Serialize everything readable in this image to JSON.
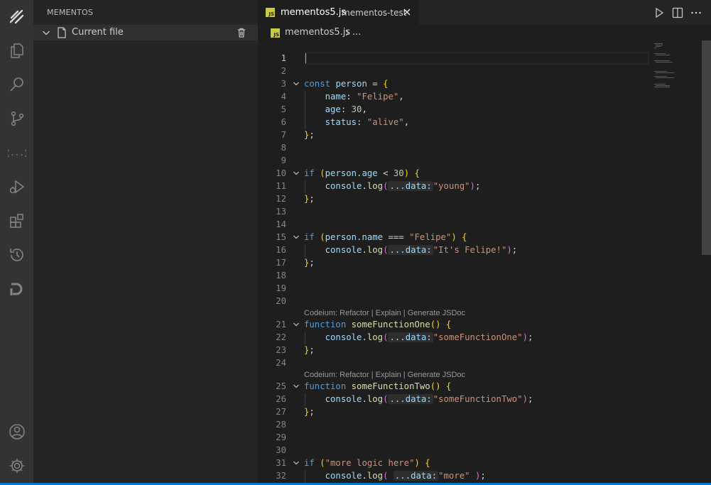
{
  "sidebar": {
    "title": "MEMENTOS",
    "items": [
      {
        "label": "Current file"
      }
    ]
  },
  "tab": {
    "name": "mementos5.js",
    "description": "mementos-test",
    "icon_text": "JS"
  },
  "breadcrumb": {
    "file": "mementos5.js",
    "more": "..."
  },
  "editor": {
    "lens_label": "Codeium: Refactor | Explain | Generate JSDoc",
    "line_numbers": [
      "1",
      "2",
      "3",
      "4",
      "5",
      "6",
      "7",
      "8",
      "9",
      "10",
      "11",
      "12",
      "13",
      "14",
      "15",
      "16",
      "17",
      "18",
      "19",
      "20",
      "21",
      "22",
      "23",
      "24",
      "25",
      "26",
      "27",
      "28",
      "29",
      "30",
      "31",
      "32"
    ],
    "code": {
      "l3": {
        "kw": "const",
        "name": "person",
        "op": " = "
      },
      "l4": {
        "key": "name",
        "val": "\"Felipe\""
      },
      "l5": {
        "key": "age",
        "val": "30"
      },
      "l6": {
        "key": "status",
        "val": "\"alive\""
      },
      "l10": {
        "kw": "if",
        "obj": "person",
        "prop": "age",
        "op": " < ",
        "num": "30"
      },
      "l11": {
        "obj": "console",
        "method": "log",
        "hint": "...data:",
        "arg": "\"young\""
      },
      "l15": {
        "kw": "if",
        "obj": "person",
        "prop": "name",
        "op": " === ",
        "str": "\"Felipe\""
      },
      "l16": {
        "obj": "console",
        "method": "log",
        "hint": "...data:",
        "arg": "\"It's Felipe!\""
      },
      "l21": {
        "kw": "function",
        "name": "someFunctionOne"
      },
      "l22": {
        "obj": "console",
        "method": "log",
        "hint": "...data:",
        "arg": "\"someFunctionOne\""
      },
      "l25": {
        "kw": "function",
        "name": "someFunctionTwo"
      },
      "l26": {
        "obj": "console",
        "method": "log",
        "hint": "...data:",
        "arg": "\"someFunctionTwo\""
      },
      "l31": {
        "kw": "if",
        "str": "\"more logic here\""
      },
      "l32": {
        "obj": "console",
        "method": "log",
        "hint": "...data:",
        "arg": "\"more\""
      }
    }
  },
  "colors": {
    "activity_bar": "#333333",
    "sidebar": "#252526",
    "editor": "#1e1e1e",
    "keyword": "#569cd6",
    "string": "#ce9178",
    "number": "#b5cea8",
    "function": "#dcdcaa",
    "status_bar": "#007acc"
  },
  "icons": {
    "activity": [
      "mementos-logo-icon",
      "explorer-icon",
      "search-icon",
      "source-control-icon",
      "json-braces-icon",
      "run-debug-icon",
      "extensions-icon",
      "history-icon",
      "codeium-icon",
      "account-icon",
      "settings-gear-icon"
    ],
    "toolbar": [
      "run-icon",
      "split-editor-icon",
      "more-actions-icon"
    ]
  }
}
